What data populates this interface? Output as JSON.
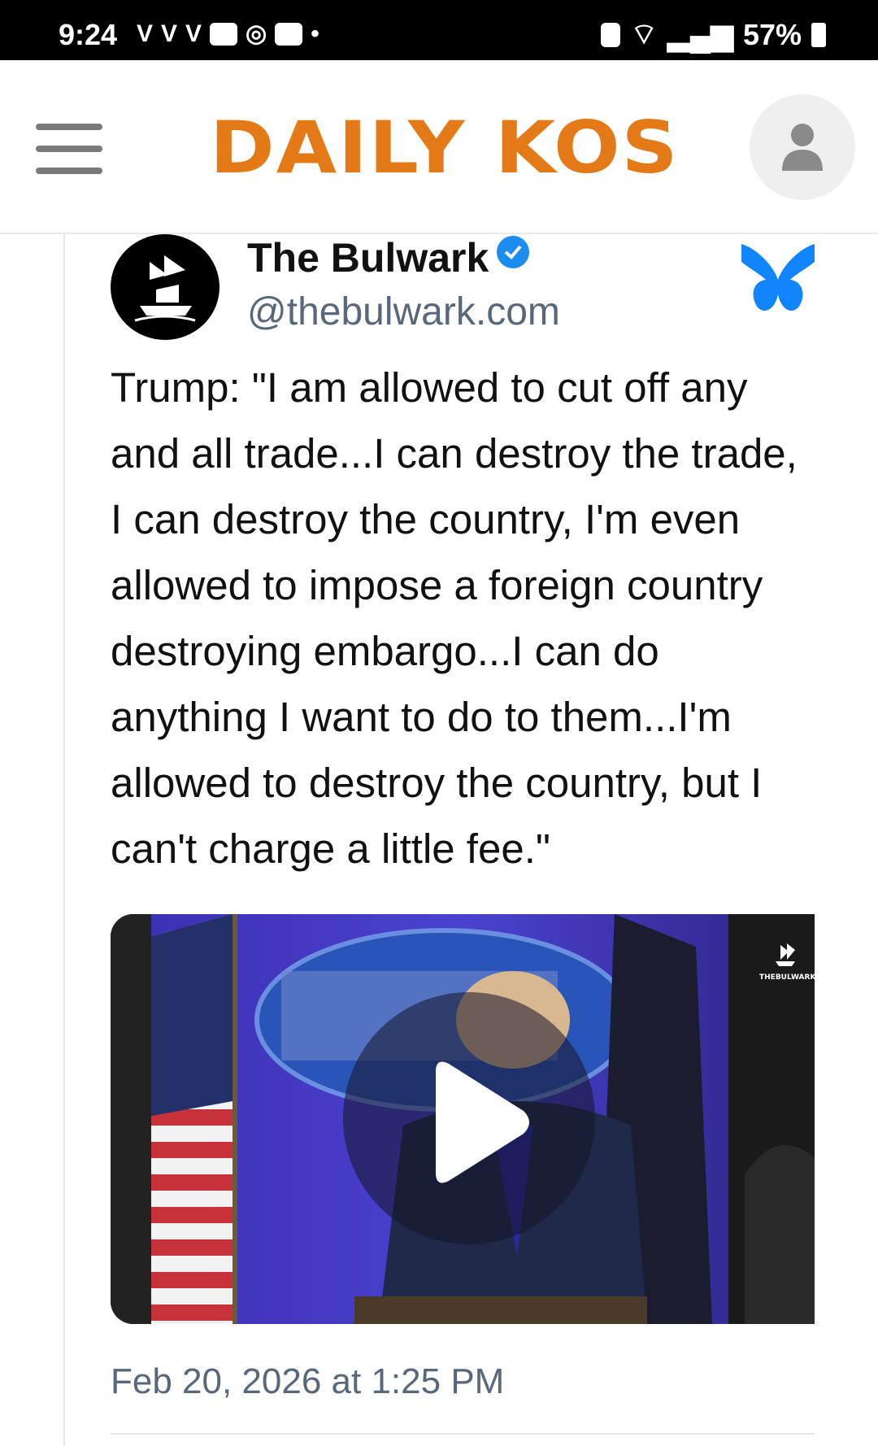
{
  "status_bar": {
    "time": "9:24",
    "notification_icons": [
      "V",
      "V",
      "V"
    ],
    "battery": "57%"
  },
  "header": {
    "logo": "DAILY KOS",
    "menu_icon": "hamburger-menu-icon",
    "account_icon": "user-icon"
  },
  "post": {
    "author": "The Bulwark",
    "handle": "@thebulwark.com",
    "text": "Trump: \"I am allowed to cut off any and all trade...I can destroy the trade, I can destroy the country, I'm even allowed to impose a foreign country destroying embargo...I can do anything I want to do to them...I'm allowed to destroy the country, but I can't charge a little fee.\"",
    "video_brand": "THEBULWARK",
    "timestamp": "Feb 20, 2026 at 1:25 PM"
  },
  "colors": {
    "logo_orange": "#e47a17",
    "bluesky_blue": "#1185fe",
    "verified_blue": "#1d8cf0",
    "handle_gray": "#58677a"
  }
}
